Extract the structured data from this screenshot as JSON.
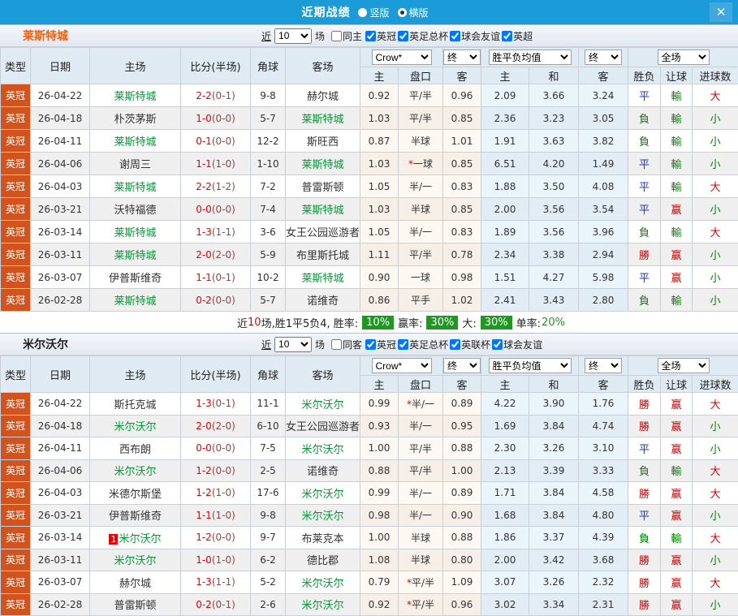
{
  "titlebar": {
    "title": "近期战绩",
    "radios": [
      {
        "label": "竖版",
        "selected": false
      },
      {
        "label": "横版",
        "selected": true
      }
    ],
    "close_icon": "✕"
  },
  "columns": {
    "type": "类型",
    "date": "日期",
    "home": "主场",
    "score": "比分(半场)",
    "corner": "角球",
    "away": "客场",
    "odds_home": "主",
    "odds_handicap": "盘口",
    "odds_away": "客",
    "avg_home": "主",
    "avg_draw": "和",
    "avg_away": "客",
    "res_wdl": "胜负",
    "res_handicap": "让球",
    "res_goals": "进球数"
  },
  "dropdowns": {
    "crow": "Crow*",
    "final": "终",
    "avg": "胜平负均值",
    "scope": "全场"
  },
  "colors": {
    "titlebar_bg": "#1b9bd8",
    "close_btn_bg": "#41a8de",
    "league_badge_bg": "#d4531d",
    "team_highlight_green": "#009933",
    "score_red": "#e60000",
    "half_score_red": "#9e4343",
    "badge_green": "#1e9820"
  },
  "result_colors": {
    "勝": "#cc0000",
    "平": "#2233cc",
    "負": "#008800",
    "赢": "#cc0000",
    "輸": "#008800",
    "大": "#dd0000",
    "小": "#008800"
  },
  "sections": [
    {
      "team": "莱斯特城",
      "team_color": "#ff5a00",
      "filters": {
        "near": "近",
        "count": "10",
        "games": "场",
        "checkboxes": [
          {
            "label": "同主",
            "checked": false
          },
          {
            "label": "英冠",
            "checked": true
          },
          {
            "label": "英足总杯",
            "checked": true
          },
          {
            "label": "球会友谊",
            "checked": true
          },
          {
            "label": "英超",
            "checked": true
          }
        ]
      },
      "rows": [
        {
          "type": "英冠",
          "date": "26-04-22",
          "home": "莱斯特城",
          "home_is_team": true,
          "home_badge": "",
          "score": "2-2",
          "half": "(0-1)",
          "corners": "9-8",
          "away": "赫尔城",
          "away_is_team": false,
          "crow_home": "0.92",
          "star": "",
          "handicap": "平/半",
          "crow_away": "0.96",
          "avg_home": "2.09",
          "avg_draw": "3.66",
          "avg_lose": "3.24",
          "res_wdl": "平",
          "res_handicap": "輸",
          "res_goals": "大"
        },
        {
          "type": "英冠",
          "date": "26-04-18",
          "home": "朴茨茅斯",
          "home_is_team": false,
          "home_badge": "",
          "score": "1-0",
          "half": "(0-0)",
          "corners": "5-7",
          "away": "莱斯特城",
          "away_is_team": true,
          "crow_home": "1.03",
          "star": "",
          "handicap": "平/半",
          "crow_away": "0.85",
          "avg_home": "2.36",
          "avg_draw": "3.23",
          "avg_lose": "3.05",
          "res_wdl": "負",
          "res_handicap": "輸",
          "res_goals": "小"
        },
        {
          "type": "英冠",
          "date": "26-04-11",
          "home": "莱斯特城",
          "home_is_team": true,
          "home_badge": "",
          "score": "0-1",
          "half": "(0-0)",
          "corners": "12-2",
          "away": "斯旺西",
          "away_is_team": false,
          "crow_home": "0.87",
          "star": "",
          "handicap": "半球",
          "crow_away": "1.01",
          "avg_home": "1.91",
          "avg_draw": "3.63",
          "avg_lose": "3.82",
          "res_wdl": "負",
          "res_handicap": "輸",
          "res_goals": "小"
        },
        {
          "type": "英冠",
          "date": "26-04-06",
          "home": "谢周三",
          "home_is_team": false,
          "home_badge": "",
          "score": "1-1",
          "half": "(1-0)",
          "corners": "1-10",
          "away": "莱斯特城",
          "away_is_team": true,
          "crow_home": "1.03",
          "star": "*",
          "handicap": "一球",
          "crow_away": "0.85",
          "avg_home": "6.51",
          "avg_draw": "4.20",
          "avg_lose": "1.49",
          "res_wdl": "平",
          "res_handicap": "輸",
          "res_goals": "小"
        },
        {
          "type": "英冠",
          "date": "26-04-03",
          "home": "莱斯特城",
          "home_is_team": true,
          "home_badge": "",
          "score": "2-2",
          "half": "(1-2)",
          "corners": "7-2",
          "away": "普雷斯顿",
          "away_is_team": false,
          "crow_home": "1.05",
          "star": "",
          "handicap": "半/一",
          "crow_away": "0.83",
          "avg_home": "1.88",
          "avg_draw": "3.50",
          "avg_lose": "4.08",
          "res_wdl": "平",
          "res_handicap": "輸",
          "res_goals": "大"
        },
        {
          "type": "英冠",
          "date": "26-03-21",
          "home": "沃特福德",
          "home_is_team": false,
          "home_badge": "",
          "score": "0-0",
          "half": "(0-0)",
          "corners": "7-4",
          "away": "莱斯特城",
          "away_is_team": true,
          "crow_home": "1.03",
          "star": "",
          "handicap": "半球",
          "crow_away": "0.85",
          "avg_home": "2.00",
          "avg_draw": "3.56",
          "avg_lose": "3.54",
          "res_wdl": "平",
          "res_handicap": "赢",
          "res_goals": "小"
        },
        {
          "type": "英冠",
          "date": "26-03-14",
          "home": "莱斯特城",
          "home_is_team": true,
          "home_badge": "",
          "score": "1-3",
          "half": "(1-1)",
          "corners": "3-6",
          "away": "女王公园巡游者",
          "away_is_team": false,
          "crow_home": "1.05",
          "star": "",
          "handicap": "半/一",
          "crow_away": "0.83",
          "avg_home": "1.89",
          "avg_draw": "3.56",
          "avg_lose": "3.96",
          "res_wdl": "負",
          "res_handicap": "輸",
          "res_goals": "大"
        },
        {
          "type": "英冠",
          "date": "26-03-11",
          "home": "莱斯特城",
          "home_is_team": true,
          "home_badge": "",
          "score": "2-0",
          "half": "(2-0)",
          "corners": "5-9",
          "away": "布里斯托城",
          "away_is_team": false,
          "crow_home": "1.11",
          "star": "",
          "handicap": "平/半",
          "crow_away": "0.78",
          "avg_home": "2.34",
          "avg_draw": "3.38",
          "avg_lose": "2.94",
          "res_wdl": "勝",
          "res_handicap": "赢",
          "res_goals": "小"
        },
        {
          "type": "英冠",
          "date": "26-03-07",
          "home": "伊普斯维奇",
          "home_is_team": false,
          "home_badge": "",
          "score": "1-1",
          "half": "(0-1)",
          "corners": "10-2",
          "away": "莱斯特城",
          "away_is_team": true,
          "crow_home": "0.90",
          "star": "",
          "handicap": "一球",
          "crow_away": "0.98",
          "avg_home": "1.51",
          "avg_draw": "4.27",
          "avg_lose": "5.98",
          "res_wdl": "平",
          "res_handicap": "赢",
          "res_goals": "小"
        },
        {
          "type": "英冠",
          "date": "26-02-28",
          "home": "莱斯特城",
          "home_is_team": true,
          "home_badge": "",
          "score": "0-2",
          "half": "(0-0)",
          "corners": "5-7",
          "away": "诺维奇",
          "away_is_team": false,
          "crow_home": "0.86",
          "star": "",
          "handicap": "平手",
          "crow_away": "1.02",
          "avg_home": "2.41",
          "avg_draw": "3.43",
          "avg_lose": "2.80",
          "res_wdl": "負",
          "res_handicap": "輸",
          "res_goals": "小"
        }
      ],
      "summary": {
        "near": "近",
        "count": "10",
        "stats": "场,胜1平5负4, 胜率:",
        "win_rate": "10%",
        "odds_label": "赢率:",
        "odds_rate": "30%",
        "big_label": "大:",
        "big_rate": "30%",
        "single_label": "单率:",
        "single_rate": "20%"
      }
    },
    {
      "team": "米尔沃尔",
      "team_color": "#222222",
      "filters": {
        "near": "近",
        "count": "10",
        "games": "场",
        "checkboxes": [
          {
            "label": "同客",
            "checked": false
          },
          {
            "label": "英冠",
            "checked": true
          },
          {
            "label": "英足总杯",
            "checked": true
          },
          {
            "label": "英联杯",
            "checked": true
          },
          {
            "label": "球会友谊",
            "checked": true
          }
        ]
      },
      "rows": [
        {
          "type": "英冠",
          "date": "26-04-22",
          "home": "斯托克城",
          "home_is_team": false,
          "home_badge": "",
          "score": "1-3",
          "half": "(0-1)",
          "corners": "11-1",
          "away": "米尔沃尔",
          "away_is_team": true,
          "crow_home": "0.99",
          "star": "*",
          "handicap": "半/一",
          "crow_away": "0.89",
          "avg_home": "4.22",
          "avg_draw": "3.90",
          "avg_lose": "1.76",
          "res_wdl": "勝",
          "res_handicap": "赢",
          "res_goals": "大"
        },
        {
          "type": "英冠",
          "date": "26-04-18",
          "home": "米尔沃尔",
          "home_is_team": true,
          "home_badge": "",
          "score": "2-0",
          "half": "(2-0)",
          "corners": "6-10",
          "away": "女王公园巡游者",
          "away_is_team": false,
          "crow_home": "0.93",
          "star": "",
          "handicap": "半/一",
          "crow_away": "0.95",
          "avg_home": "1.69",
          "avg_draw": "3.84",
          "avg_lose": "4.74",
          "res_wdl": "勝",
          "res_handicap": "赢",
          "res_goals": "小"
        },
        {
          "type": "英冠",
          "date": "26-04-11",
          "home": "西布朗",
          "home_is_team": false,
          "home_badge": "",
          "score": "0-0",
          "half": "(0-0)",
          "corners": "7-5",
          "away": "米尔沃尔",
          "away_is_team": true,
          "crow_home": "1.00",
          "star": "",
          "handicap": "平/半",
          "crow_away": "0.88",
          "avg_home": "2.30",
          "avg_draw": "3.26",
          "avg_lose": "3.10",
          "res_wdl": "平",
          "res_handicap": "赢",
          "res_goals": "小"
        },
        {
          "type": "英冠",
          "date": "26-04-06",
          "home": "米尔沃尔",
          "home_is_team": true,
          "home_badge": "",
          "score": "1-2",
          "half": "(0-0)",
          "corners": "2-5",
          "away": "诺维奇",
          "away_is_team": false,
          "crow_home": "0.88",
          "star": "",
          "handicap": "平/半",
          "crow_away": "1.00",
          "avg_home": "2.13",
          "avg_draw": "3.39",
          "avg_lose": "3.33",
          "res_wdl": "負",
          "res_handicap": "輸",
          "res_goals": "大"
        },
        {
          "type": "英冠",
          "date": "26-04-03",
          "home": "米德尔斯堡",
          "home_is_team": false,
          "home_badge": "",
          "score": "1-2",
          "half": "(1-0)",
          "corners": "17-6",
          "away": "米尔沃尔",
          "away_is_team": true,
          "crow_home": "0.99",
          "star": "",
          "handicap": "半/一",
          "crow_away": "0.89",
          "avg_home": "1.71",
          "avg_draw": "3.84",
          "avg_lose": "4.58",
          "res_wdl": "勝",
          "res_handicap": "赢",
          "res_goals": "大"
        },
        {
          "type": "英冠",
          "date": "26-03-21",
          "home": "伊普斯维奇",
          "home_is_team": false,
          "home_badge": "",
          "score": "1-1",
          "half": "(1-0)",
          "corners": "9-8",
          "away": "米尔沃尔",
          "away_is_team": true,
          "crow_home": "0.98",
          "star": "",
          "handicap": "半/一",
          "crow_away": "0.90",
          "avg_home": "1.68",
          "avg_draw": "3.84",
          "avg_lose": "4.80",
          "res_wdl": "平",
          "res_handicap": "赢",
          "res_goals": "小"
        },
        {
          "type": "英冠",
          "date": "26-03-14",
          "home": "米尔沃尔",
          "home_is_team": true,
          "home_badge": "1",
          "score": "1-2",
          "half": "(0-0)",
          "corners": "9-7",
          "away": "布莱克本",
          "away_is_team": false,
          "crow_home": "1.00",
          "star": "",
          "handicap": "半球",
          "crow_away": "0.88",
          "avg_home": "1.86",
          "avg_draw": "3.37",
          "avg_lose": "4.39",
          "res_wdl": "負",
          "res_handicap": "輸",
          "res_goals": "大"
        },
        {
          "type": "英冠",
          "date": "26-03-11",
          "home": "米尔沃尔",
          "home_is_team": true,
          "home_badge": "",
          "score": "1-0",
          "half": "(1-0)",
          "corners": "6-2",
          "away": "德比郡",
          "away_is_team": false,
          "crow_home": "1.08",
          "star": "",
          "handicap": "半球",
          "crow_away": "0.80",
          "avg_home": "2.00",
          "avg_draw": "3.42",
          "avg_lose": "3.68",
          "res_wdl": "勝",
          "res_handicap": "赢",
          "res_goals": "小"
        },
        {
          "type": "英冠",
          "date": "26-03-07",
          "home": "赫尔城",
          "home_is_team": false,
          "home_badge": "",
          "score": "1-3",
          "half": "(1-1)",
          "corners": "5-2",
          "away": "米尔沃尔",
          "away_is_team": true,
          "crow_home": "0.79",
          "star": "*",
          "handicap": "平/半",
          "crow_away": "1.09",
          "avg_home": "3.07",
          "avg_draw": "3.26",
          "avg_lose": "2.32",
          "res_wdl": "勝",
          "res_handicap": "赢",
          "res_goals": "大"
        },
        {
          "type": "英冠",
          "date": "26-02-28",
          "home": "普雷斯顿",
          "home_is_team": false,
          "home_badge": "",
          "score": "0-2",
          "half": "(0-1)",
          "corners": "2-6",
          "away": "米尔沃尔",
          "away_is_team": true,
          "crow_home": "0.92",
          "star": "*",
          "handicap": "平/半",
          "crow_away": "0.96",
          "avg_home": "3.02",
          "avg_draw": "3.34",
          "avg_lose": "2.31",
          "res_wdl": "勝",
          "res_handicap": "赢",
          "res_goals": "小"
        }
      ]
    }
  ]
}
